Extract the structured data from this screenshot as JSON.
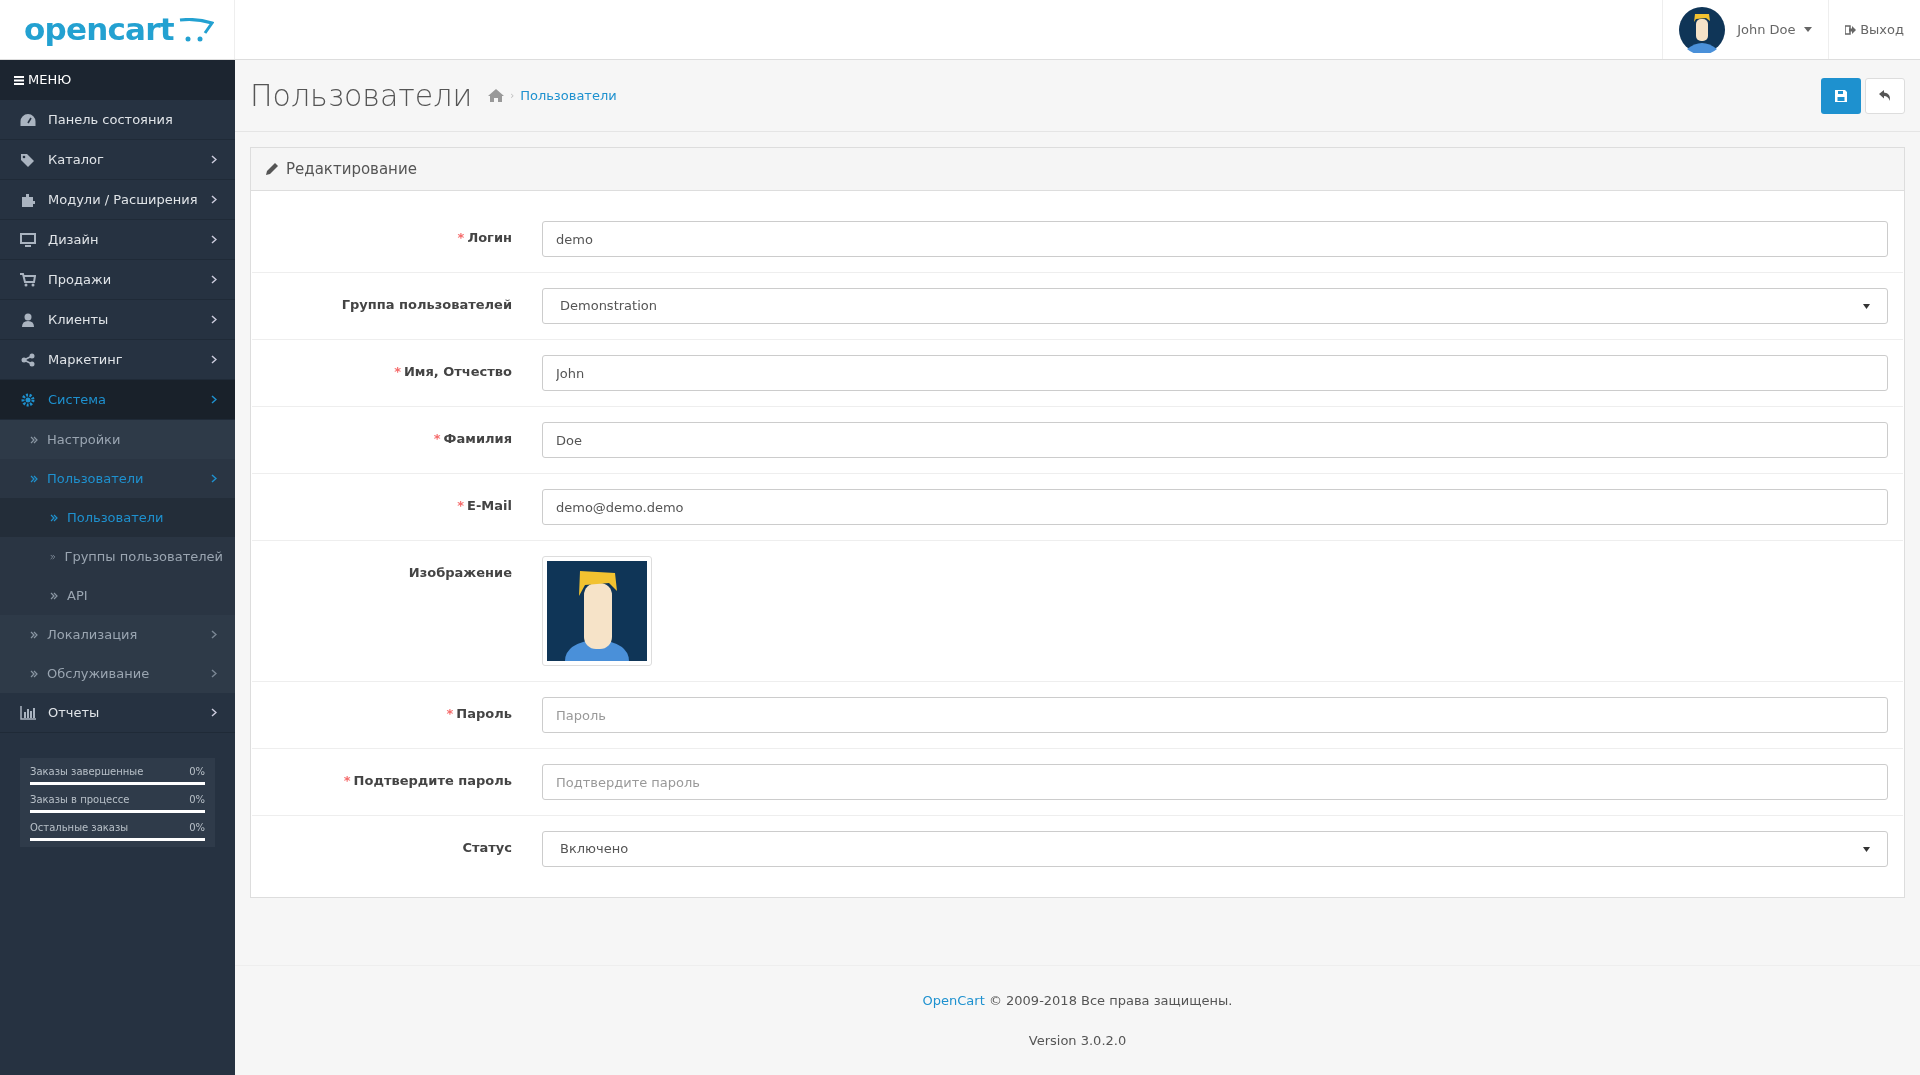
{
  "logo": {
    "text": "opencart"
  },
  "header": {
    "user": "John Doe",
    "logout": "Выход"
  },
  "sidebar": {
    "menu_label": "МЕНЮ",
    "items": [
      {
        "label": "Панель состояния",
        "has_submenu": false,
        "selected": false
      },
      {
        "label": "Каталог",
        "has_submenu": true,
        "selected": false
      },
      {
        "label": "Модули / Расширения",
        "has_submenu": true,
        "selected": false
      },
      {
        "label": "Дизайн",
        "has_submenu": true,
        "selected": false
      },
      {
        "label": "Продажи",
        "has_submenu": true,
        "selected": false
      },
      {
        "label": "Клиенты",
        "has_submenu": true,
        "selected": false
      },
      {
        "label": "Маркетинг",
        "has_submenu": true,
        "selected": false
      },
      {
        "label": "Система",
        "has_submenu": true,
        "selected": true,
        "children": [
          {
            "label": "Настройки",
            "has_submenu": false,
            "selected": false
          },
          {
            "label": "Пользователи",
            "has_submenu": true,
            "selected": true,
            "children": [
              {
                "label": "Пользователи",
                "has_submenu": false,
                "selected": true
              },
              {
                "label": "Группы пользователей",
                "has_submenu": false,
                "selected": false
              },
              {
                "label": "API",
                "has_submenu": false,
                "selected": false
              }
            ]
          },
          {
            "label": "Локализация",
            "has_submenu": true,
            "selected": false
          },
          {
            "label": "Обслуживание",
            "has_submenu": true,
            "selected": false
          }
        ]
      },
      {
        "label": "Отчеты",
        "has_submenu": true,
        "selected": false
      }
    ],
    "stats": [
      {
        "label": "Заказы завершенные",
        "reading": "0%",
        "level": 0
      },
      {
        "label": "Заказы в процессе",
        "reading": "0%",
        "level": 0
      },
      {
        "label": "Остальные заказы",
        "reading": "0%",
        "level": 0
      }
    ]
  },
  "page": {
    "title": "Пользователи",
    "separator": "›",
    "breadcrumb": [
      "Пользователи"
    ]
  },
  "panel": {
    "title": "Редактирование",
    "required_mark": "*",
    "rows": [
      {
        "kind": "input",
        "label": "Логин",
        "required": true,
        "value": "demo"
      },
      {
        "kind": "select",
        "label": "Группа пользователей",
        "required": false,
        "value": "Demonstration"
      },
      {
        "kind": "input",
        "label": "Имя, Отчество",
        "required": true,
        "value": "John"
      },
      {
        "kind": "input",
        "label": "Фамилия",
        "required": true,
        "value": "Doe"
      },
      {
        "kind": "input",
        "label": "E-Mail",
        "required": true,
        "value": "demo@demo.demo"
      },
      {
        "kind": "image",
        "label": "Изображение",
        "required": false
      },
      {
        "kind": "input",
        "label": "Пароль",
        "required": true,
        "placeholder": "Пароль"
      },
      {
        "kind": "input",
        "label": "Подтвердите пароль",
        "required": true,
        "placeholder": "Подтвердите пароль"
      },
      {
        "kind": "select",
        "label": "Статус",
        "required": false,
        "value": "Включено"
      }
    ]
  },
  "footer": {
    "link": "OpenCart",
    "text": "© 2009-2018 Все права защищены.",
    "version": "Version 3.0.2.0"
  }
}
